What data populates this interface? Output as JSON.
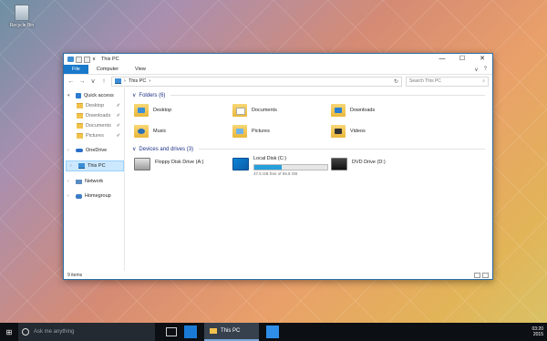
{
  "desktop": {
    "recycle_bin_label": "Recycle Bin"
  },
  "window": {
    "title": "This PC",
    "quick_access_dropdown": "∨",
    "controls": {
      "minimize": "—",
      "maximize": "☐",
      "close": "✕"
    }
  },
  "ribbon": {
    "tabs": [
      "File",
      "Computer",
      "View"
    ],
    "expand_icon": "∨",
    "help_icon": "?"
  },
  "nav": {
    "back": "←",
    "forward": "→",
    "recent": "∨",
    "up": "↑",
    "address_path": "This PC",
    "address_chevron": "›",
    "refresh": "↻",
    "search_placeholder": "Search This PC",
    "search_icon": "⌕"
  },
  "sidebar": {
    "quick_access": "Quick access",
    "pinned": [
      "Desktop",
      "Downloads",
      "Documents",
      "Pictures"
    ],
    "onedrive": "OneDrive",
    "this_pc": "This PC",
    "network": "Network",
    "homegroup": "Homegroup",
    "pin_glyph": "✐"
  },
  "folders": {
    "header": "Folders (6)",
    "items": [
      "Desktop",
      "Documents",
      "Downloads",
      "Music",
      "Pictures",
      "Videos"
    ]
  },
  "drives": {
    "header": "Devices and drives (3)",
    "floppy": "Floppy Disk Drive (A:)",
    "local": {
      "name": "Local Disk (C:)",
      "free_text": "37.5 GB free of 59.8 GB",
      "used_fraction": 0.373
    },
    "dvd": "DVD Drive (D:)"
  },
  "status": {
    "item_count": "9 items"
  },
  "taskbar": {
    "search_placeholder": "Ask me anything",
    "explorer_label": "This PC",
    "clock": "03:20",
    "date": "2015"
  },
  "colors": {
    "accent": "#1979ca",
    "selection": "#cce8ff",
    "drive_bar": "#26a0da"
  }
}
